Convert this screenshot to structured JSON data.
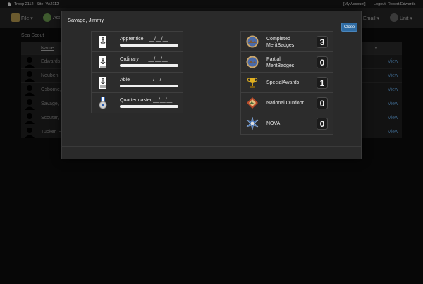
{
  "topbar": {
    "troop": "Troop 2112",
    "site": "Site: VA2112",
    "account": "[My Account]",
    "logout": "Logout: Robert.Edwards"
  },
  "menu": {
    "file": "File ▾",
    "activities": "Act",
    "email": "Email ▾",
    "unit": "Unit ▾"
  },
  "background": {
    "section_title": "Sea Scout",
    "name_header": "Name",
    "rows": [
      {
        "name": "Edwards,",
        "action": "View"
      },
      {
        "name": "Neuben, ",
        "action": "View"
      },
      {
        "name": "Osborne,",
        "action": "View"
      },
      {
        "name": "Savage, J",
        "action": "View"
      },
      {
        "name": "Scouter, ",
        "action": "View"
      },
      {
        "name": "Tucker, F",
        "action": "View"
      }
    ]
  },
  "modal": {
    "title": "Savage, Jimmy",
    "close_label": "Close",
    "ranks": [
      {
        "label": "Apprentice    __/__/__",
        "icon": "apprentice-rank-icon"
      },
      {
        "label": "Ordinary       __/__/__",
        "icon": "ordinary-rank-icon"
      },
      {
        "label": "Able             __/__/__",
        "icon": "able-rank-icon"
      },
      {
        "label": "Quartermaster __/__/__",
        "icon": "quartermaster-medal-icon"
      }
    ],
    "awards": [
      {
        "line1": "Completed",
        "line2": "MeritBadges",
        "count": "3",
        "icon": "merit-badge-icon"
      },
      {
        "line1": "Partial",
        "line2": "MeritBadges",
        "count": "0",
        "icon": "merit-badge-icon"
      },
      {
        "line1": "SpecialAwards",
        "line2": "",
        "count": "1",
        "icon": "trophy-icon"
      },
      {
        "line1": "National Outdoor",
        "line2": "",
        "count": "0",
        "icon": "national-outdoor-icon"
      },
      {
        "line1": "NOVA",
        "line2": "",
        "count": "0",
        "icon": "nova-icon"
      }
    ]
  },
  "colors": {
    "accent": "#2f6ca4",
    "modal_bg": "#2a2a2a",
    "page_bg": "#070707"
  }
}
